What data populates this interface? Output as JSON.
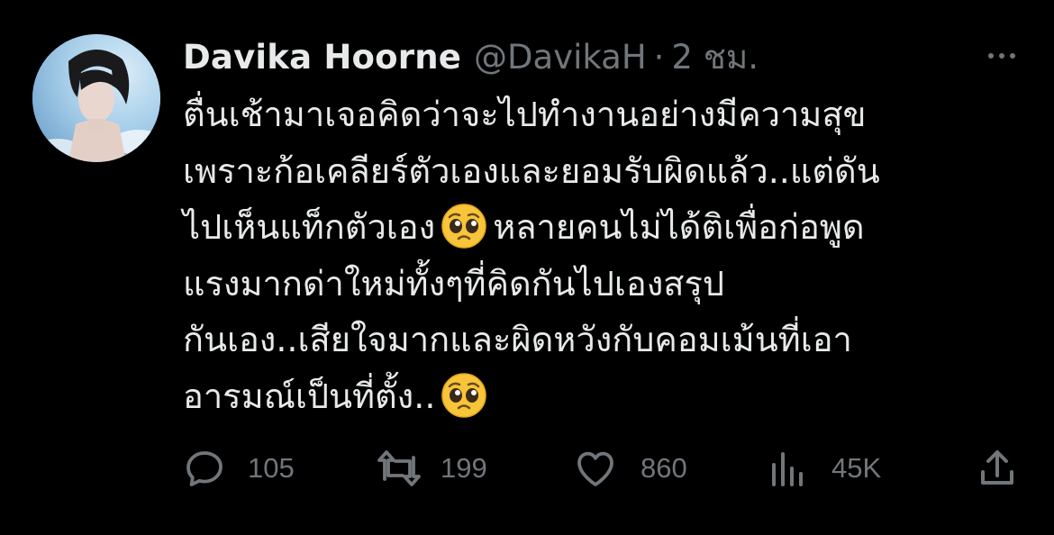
{
  "author": {
    "name": "Davika Hoorne",
    "handle": "@DavikaH",
    "separator": "·",
    "time": "2 ชม."
  },
  "tweet": {
    "lines": [
      "ตื่นเช้ามาเจอคิดว่าจะไปทำงานอย่างมีความสุข",
      "เพราะก้อเคลียร์ตัวเองและยอมรับผิดแล้ว..แต่ดัน",
      "ไปเห็นแท็กตัวเอง",
      "หลายคนไม่ได้ติเพื่อก่อพูด",
      "แรงมากด่าใหม่ทั้งๆที่คิดกันไปเองสรุป",
      "กันเอง..เสียใจมากและผิดหวังกับคอมเม้นที่เอา",
      "อารมณ์เป็นที่ตั้ง.."
    ],
    "emoji": "pleading-face"
  },
  "actions": {
    "replies": "105",
    "retweets": "199",
    "likes": "860",
    "views": "45K"
  },
  "colors": {
    "background": "#000000",
    "text": "#e7e9ea",
    "muted": "#71767b"
  }
}
